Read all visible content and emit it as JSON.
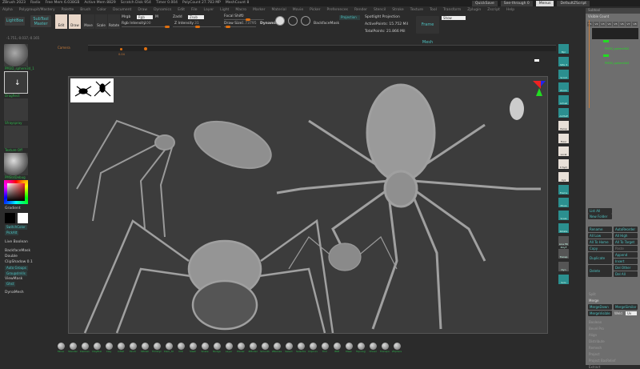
{
  "title_bar": {
    "items": [
      "ZBrush 2023",
      "Radix",
      "Free Mem 6.038GB",
      "Active Mem 8829",
      "Scratch Disk 954",
      "Timer 0.004",
      "PolyCount 27.783 MP",
      "MeshCount 8"
    ]
  },
  "top_right": {
    "quicksave": "QuickSave",
    "seethrough": "See-through 0",
    "menus": "Menus",
    "script": "DefaultZScript"
  },
  "menu": [
    "Alpha",
    "Polygroupit/Mastery",
    "Palette",
    "Brush",
    "Color",
    "Document",
    "Draw",
    "Dynamics",
    "Edit",
    "File",
    "Layer",
    "Light",
    "Macro",
    "Marker",
    "Material",
    "Movie",
    "Picker",
    "Preferences",
    "Render",
    "Stencil",
    "Stroke",
    "Texture",
    "Tool",
    "Transform",
    "Zplugin",
    "Zscript",
    "Help"
  ],
  "toolbar": {
    "lightbox": "LightBox",
    "subtool_master": "SubTool Master",
    "edit": "Edit",
    "draw": "Draw",
    "move": "Move",
    "scale": "Scale",
    "rotate": "Rotate",
    "mrgb_label": "Mrgb",
    "rgb_value": "Rgb",
    "m_label": "M",
    "rgb_intensity_label": "Rgb Intensity",
    "rgb_intensity": "100",
    "zadd_label": "Zadd",
    "zadd_value": "Zsub",
    "z_intensity_label": "Z Intensity",
    "z_intensity": "31",
    "focal_shift_label": "Focal Shift",
    "focal_shift": "0",
    "draw_size_label": "Draw Size",
    "draw_size": "1.73795",
    "dynamic": "Dynamic",
    "backface": "BackfaceMask",
    "projection": "Projection",
    "spotlight": "Spotlight Projection",
    "active_points": "ActivePoints: 15.752 Mil",
    "total_points": "TotalPoints: 21.866 Mil",
    "frame_mesh": "Frame Mesh",
    "show": "Show"
  },
  "coords": "-1.751,-0.037,-0.165",
  "timeline": {
    "label": "Camera",
    "marker": "0.04"
  },
  "left_panel": {
    "thumbs": [
      "PM3D_sphere3d_1",
      "DragRect",
      "Sfrayspray",
      "Texture Off",
      "PMStdDebug"
    ],
    "gradient": "Gradient",
    "switch_color": "SwitchColor",
    "pick_alt": "PickAlt",
    "items": [
      "Live Boolean",
      "BackfaceMask",
      "Double",
      "ClipShadow 0.1"
    ],
    "auto_groups": "Auto Groups",
    "groups_split": "GroupsInVis",
    "viewmask": "ViewMask",
    "ghost": "Ghst",
    "dynamesh": "DynaMesh"
  },
  "shelf": [
    "Bpr",
    "SPix 3",
    "Scroll",
    "Zoom",
    "Actual",
    "AAHalf",
    "Persp",
    "Floor",
    "Local",
    "X Sym",
    "Xyz",
    "Frame",
    "Move",
    "Scale",
    "Rotate",
    "Line Fill PolyF",
    "Transp",
    "Dyn",
    "Solo"
  ],
  "right_panel": {
    "title": "Subtool",
    "visible_count": "Visible Count",
    "tabs": [
      "V1",
      "V2",
      "V3",
      "V4",
      "V5",
      "V6",
      "V7",
      "V8"
    ],
    "subtools": [
      "PM3D_sphere3d2",
      "PM3D_sphere3d3"
    ],
    "list_all": "List All",
    "new_folder": "New Folder",
    "rename": "Rename",
    "autoreorder": "AutoReorder",
    "all_low": "All Low",
    "all_high": "All High",
    "all_to_home": "All To Home",
    "all_to_target": "All To Target",
    "copy": "Copy",
    "paste": "Paste",
    "duplicate": "Duplicate",
    "append": "Append",
    "insert": "Insert",
    "delete": "Delete",
    "del_other": "Del Other",
    "del_all": "Del All",
    "split": "Split",
    "merge": "Merge",
    "merge_down": "MergeDown",
    "merge_similar": "MergeSimilar",
    "merge_visible": "MergeVisible",
    "weld": "Weld",
    "uv": "Uv",
    "sections": [
      "Boolean",
      "Bevel Pro",
      "Align",
      "Distribute",
      "Remesh",
      "Project",
      "Project BasRelief",
      "Extract"
    ]
  },
  "brushes": [
    "Move",
    "Standard",
    "Damian",
    "ClayBuild",
    "Clay",
    "Inflat",
    "Pinch",
    "hPolish",
    "TrimDyn",
    "Dam_St",
    "Orb",
    "Slash",
    "Snake",
    "Nudge",
    "Layer",
    "Planar",
    "ZModel",
    "Smooth",
    "ZRemesh",
    "Select",
    "Selectrect",
    "ClipCurve",
    "Trim",
    "IMM",
    "Mask",
    "Topology",
    "Chisel",
    "Transpose",
    "ZSphere"
  ]
}
